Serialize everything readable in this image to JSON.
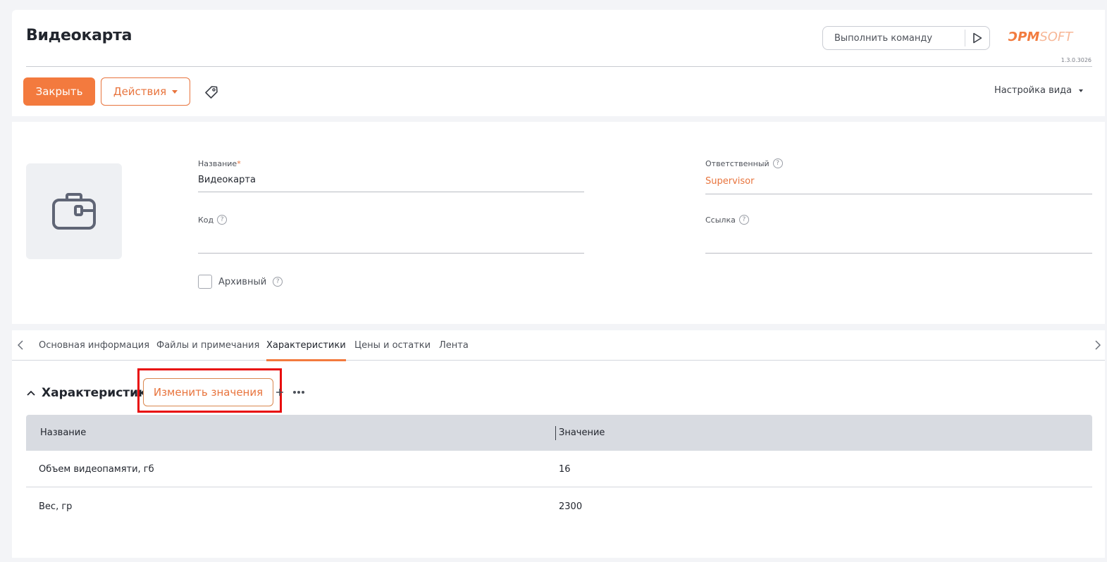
{
  "header": {
    "title": "Видеокарта",
    "command_placeholder": "Выполнить команду",
    "logo_main": "ƆPM",
    "logo_soft": "SOFT",
    "version": "1.3.0.3026",
    "close_label": "Закрыть",
    "actions_label": "Действия",
    "view_settings_label": "Настройка вида"
  },
  "info": {
    "name_label": "Название",
    "name_required_mark": "*",
    "name_value": "Видеокарта",
    "owner_label": "Ответственный",
    "owner_value": "Supervisor",
    "code_label": "Код",
    "code_value": "",
    "link_label": "Ссылка",
    "link_value": "",
    "archive_label": "Архивный",
    "archive_checked": false,
    "image_icon": "briefcase-icon"
  },
  "tabs": [
    {
      "label": "Основная информация",
      "active": false
    },
    {
      "label": "Файлы и примечания",
      "active": false
    },
    {
      "label": "Характеристики",
      "active": true
    },
    {
      "label": "Цены и остатки",
      "active": false
    },
    {
      "label": "Лента",
      "active": false
    }
  ],
  "characteristics": {
    "title": "Характеристики",
    "edit_values_label": "Изменить значения",
    "columns": [
      "Название",
      "Значение"
    ],
    "rows": [
      {
        "name": "Объем видеопамяти, гб",
        "value": "16"
      },
      {
        "name": "Вес, гр",
        "value": "2300"
      }
    ]
  },
  "colors": {
    "accent": "#f37a3e",
    "highlight_frame": "#e80b0b",
    "grid_header_bg": "#d8dbe1"
  }
}
